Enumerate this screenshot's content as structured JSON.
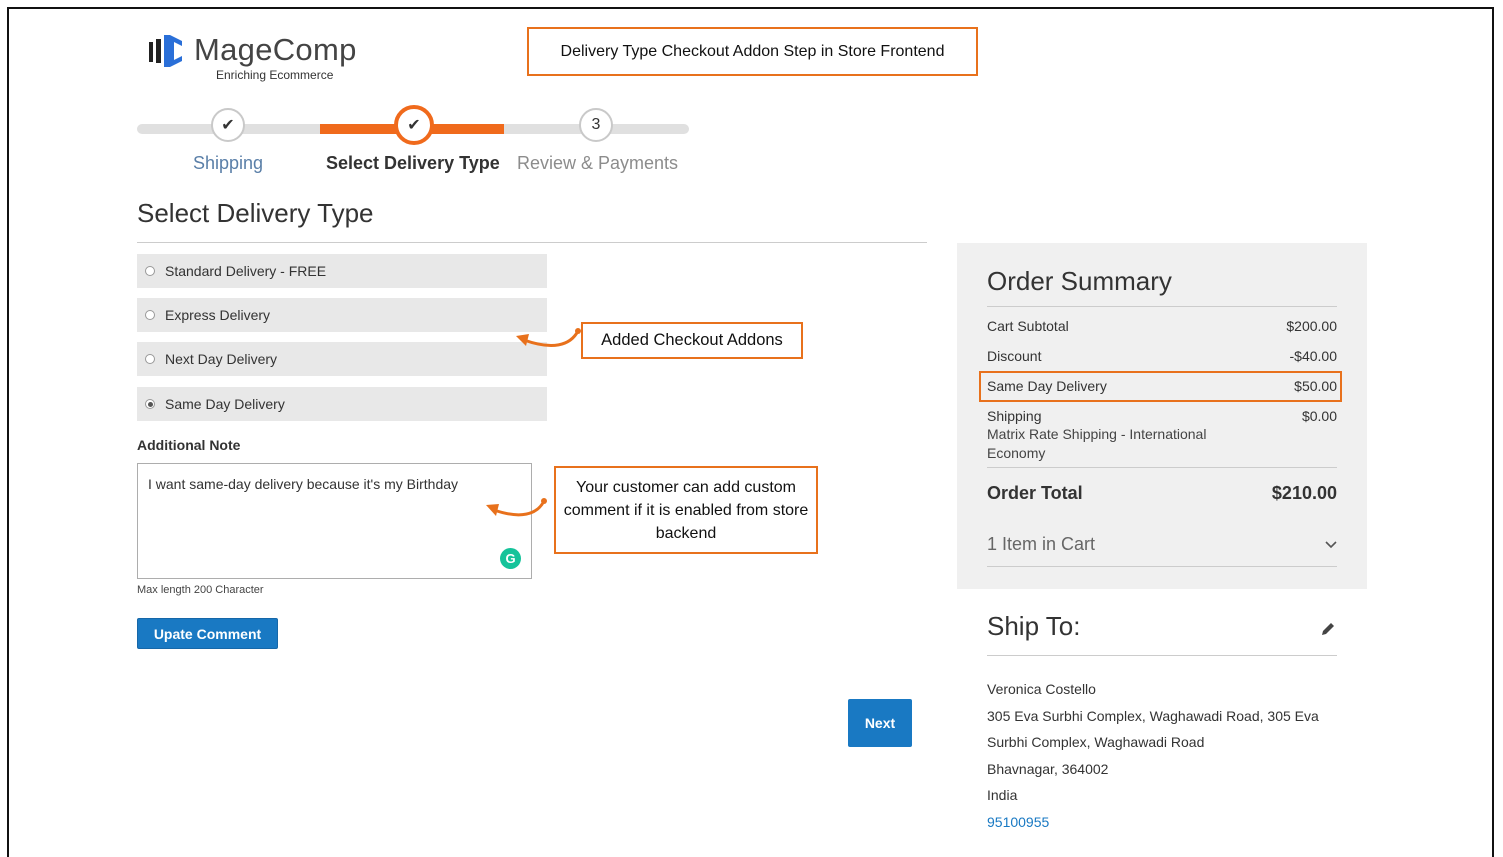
{
  "logo": {
    "name": "MageComp",
    "tagline": "Enriching Ecommerce"
  },
  "callouts": {
    "title": "Delivery Type Checkout Addon Step in Store Frontend",
    "addons": "Added Checkout Addons",
    "comment": "Your customer can add custom comment if it is enabled from store backend"
  },
  "progress": {
    "steps": [
      {
        "label": "Shipping",
        "badge": "✔",
        "state": "done"
      },
      {
        "label": "Select Delivery Type",
        "badge": "✔",
        "state": "current"
      },
      {
        "label": "Review & Payments",
        "badge": "3",
        "state": "future"
      }
    ]
  },
  "main": {
    "title": "Select Delivery Type",
    "options": [
      {
        "label": "Standard Delivery - FREE",
        "checked": false
      },
      {
        "label": "Express Delivery",
        "checked": false
      },
      {
        "label": "Next Day Delivery",
        "checked": false
      },
      {
        "label": "Same Day Delivery",
        "checked": true
      }
    ],
    "note_label": "Additional Note",
    "note_value": "I want same-day delivery because it's my Birthday",
    "note_hint": "Max length 200 Character",
    "update_button": "Upate Comment",
    "next_button": "Next"
  },
  "summary": {
    "title": "Order Summary",
    "rows": [
      {
        "label": "Cart Subtotal",
        "value": "$200.00"
      },
      {
        "label": "Discount",
        "value": "-$40.00"
      },
      {
        "label": "Same Day Delivery",
        "value": "$50.00"
      },
      {
        "label": "Shipping",
        "value": "$0.00"
      }
    ],
    "shipping_method": "Matrix Rate Shipping - International Economy",
    "total_label": "Order Total",
    "total_value": "$210.00",
    "items_label": "1 Item in Cart"
  },
  "ship_to": {
    "title": "Ship To:",
    "lines": [
      "Veronica Costello",
      "305 Eva Surbhi Complex, Waghawadi Road, 305 Eva",
      "Surbhi Complex, Waghawadi Road",
      "Bhavnagar, 364002",
      "India"
    ],
    "phone": "95100955"
  },
  "colors": {
    "accent": "#f06a1c",
    "button": "#1979c3",
    "callout_border": "#e8711c"
  }
}
